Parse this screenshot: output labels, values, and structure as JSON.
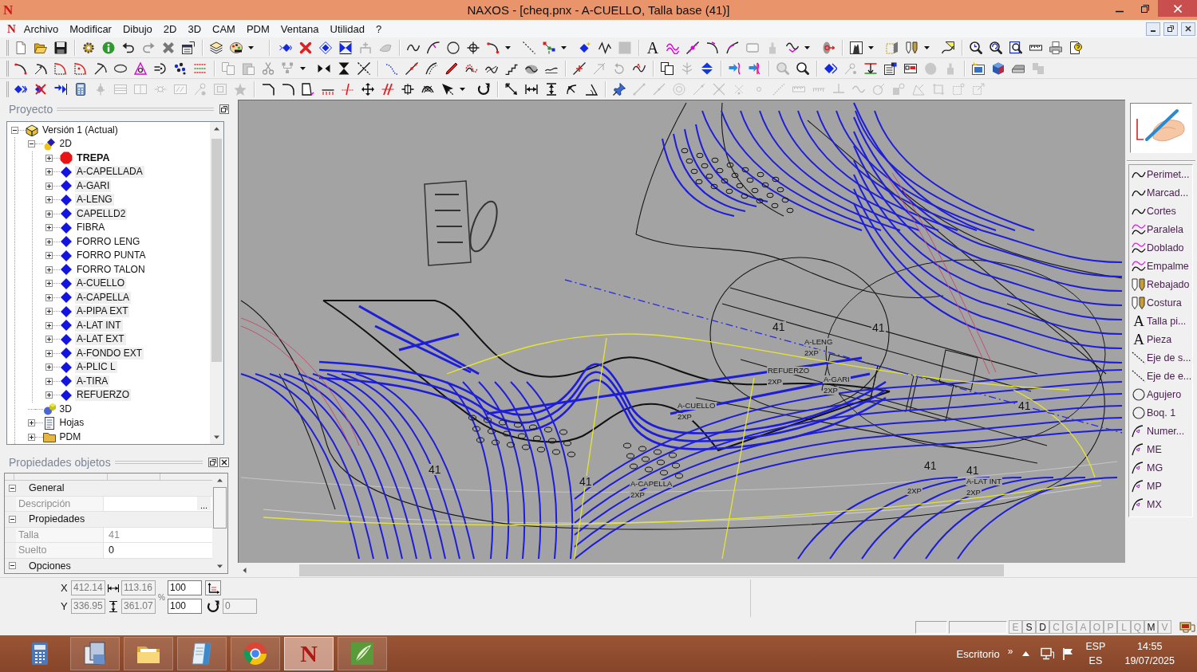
{
  "window": {
    "logo": "N",
    "title": "NAXOS - [cheq.pnx - A-CUELLO, Talla base (41)]"
  },
  "menu_bar": {
    "logo": "N",
    "items": [
      "Archivo",
      "Modificar",
      "Dibujo",
      "2D",
      "3D",
      "CAM",
      "PDM",
      "Ventana",
      "Utilidad",
      "?"
    ]
  },
  "toolbars": [
    {
      "groups": [
        [
          {
            "kind": "button",
            "disabled": false
          },
          {
            "kind": "button",
            "disabled": false
          },
          {
            "kind": "button",
            "disabled": false
          }
        ],
        [
          {
            "kind": "button",
            "disabled": false
          },
          {
            "kind": "button",
            "disabled": false
          },
          {
            "kind": "button",
            "disabled": false
          },
          {
            "kind": "button",
            "disabled": true
          },
          {
            "kind": "button",
            "disabled": false
          },
          {
            "kind": "button",
            "disabled": false
          }
        ],
        [
          {
            "kind": "button",
            "disabled": false
          },
          {
            "kind": "menu_button",
            "disabled": false
          }
        ],
        [
          {
            "kind": "button",
            "disabled": false
          },
          {
            "kind": "button",
            "disabled": false
          },
          {
            "kind": "button",
            "disabled": false
          },
          {
            "kind": "button",
            "disabled": false
          },
          {
            "kind": "button",
            "disabled": true
          },
          {
            "kind": "button",
            "disabled": true
          }
        ],
        [
          {
            "kind": "button",
            "disabled": false
          },
          {
            "kind": "button",
            "disabled": false
          },
          {
            "kind": "button",
            "disabled": false
          },
          {
            "kind": "button",
            "disabled": false
          },
          {
            "kind": "menu_button",
            "disabled": false
          },
          {
            "kind": "button",
            "disabled": false
          },
          {
            "kind": "menu_button",
            "disabled": false
          },
          {
            "kind": "button",
            "disabled": false
          },
          {
            "kind": "button",
            "disabled": false
          },
          {
            "kind": "button",
            "disabled": true
          }
        ],
        [
          {
            "kind": "button",
            "glyph": "A",
            "disabled": false
          },
          {
            "kind": "button",
            "disabled": false
          },
          {
            "kind": "button",
            "disabled": false
          },
          {
            "kind": "button",
            "disabled": false
          },
          {
            "kind": "button",
            "disabled": false
          },
          {
            "kind": "button",
            "disabled": true
          },
          {
            "kind": "button",
            "disabled": true
          },
          {
            "kind": "menu_button",
            "disabled": false
          },
          {
            "kind": "button",
            "disabled": false
          }
        ],
        [
          {
            "kind": "menu_button",
            "disabled": false
          },
          {
            "kind": "button",
            "disabled": false
          },
          {
            "kind": "menu_button",
            "disabled": false
          },
          {
            "kind": "button",
            "disabled": false
          }
        ],
        [
          {
            "kind": "button",
            "disabled": false
          },
          {
            "kind": "button",
            "disabled": false
          },
          {
            "kind": "button",
            "disabled": false
          },
          {
            "kind": "button",
            "disabled": false
          },
          {
            "kind": "button",
            "disabled": false
          },
          {
            "kind": "button",
            "disabled": false
          }
        ]
      ]
    },
    {
      "groups": [
        [
          {
            "kind": "button",
            "disabled": false
          },
          {
            "kind": "button",
            "disabled": false
          },
          {
            "kind": "button",
            "disabled": false
          },
          {
            "kind": "button",
            "disabled": false
          },
          {
            "kind": "button",
            "disabled": false
          },
          {
            "kind": "button",
            "disabled": false
          },
          {
            "kind": "button",
            "disabled": false
          },
          {
            "kind": "button",
            "disabled": false
          },
          {
            "kind": "button",
            "disabled": false
          },
          {
            "kind": "button",
            "disabled": false
          }
        ],
        [
          {
            "kind": "button",
            "disabled": true
          },
          {
            "kind": "button",
            "disabled": true
          },
          {
            "kind": "button",
            "disabled": true
          },
          {
            "kind": "menu_button",
            "disabled": true
          },
          {
            "kind": "button",
            "disabled": false
          },
          {
            "kind": "button",
            "disabled": false
          },
          {
            "kind": "button",
            "disabled": false
          }
        ],
        [
          {
            "kind": "button",
            "disabled": false
          },
          {
            "kind": "button",
            "disabled": false
          },
          {
            "kind": "button",
            "disabled": false
          },
          {
            "kind": "button",
            "disabled": false
          },
          {
            "kind": "button",
            "disabled": false
          },
          {
            "kind": "button",
            "disabled": false
          },
          {
            "kind": "button",
            "disabled": false
          },
          {
            "kind": "button",
            "disabled": false
          },
          {
            "kind": "button",
            "disabled": false
          }
        ],
        [
          {
            "kind": "button",
            "disabled": false
          },
          {
            "kind": "button",
            "disabled": true
          },
          {
            "kind": "button",
            "disabled": true
          },
          {
            "kind": "button",
            "disabled": false
          }
        ],
        [
          {
            "kind": "button",
            "disabled": false
          },
          {
            "kind": "button",
            "disabled": true
          },
          {
            "kind": "button",
            "disabled": false
          }
        ],
        [
          {
            "kind": "button",
            "disabled": false
          },
          {
            "kind": "button",
            "disabled": false
          }
        ],
        [
          {
            "kind": "button",
            "disabled": true
          },
          {
            "kind": "button",
            "disabled": false
          }
        ],
        [
          {
            "kind": "button",
            "disabled": false
          },
          {
            "kind": "button",
            "disabled": true
          },
          {
            "kind": "button",
            "disabled": false
          },
          {
            "kind": "button",
            "disabled": false
          },
          {
            "kind": "button",
            "disabled": false
          },
          {
            "kind": "button",
            "disabled": true
          },
          {
            "kind": "button",
            "disabled": true
          }
        ],
        [
          {
            "kind": "button",
            "disabled": false
          },
          {
            "kind": "button",
            "disabled": false
          },
          {
            "kind": "button",
            "disabled": false
          },
          {
            "kind": "button",
            "disabled": true
          }
        ]
      ]
    },
    {
      "groups": [
        [
          {
            "kind": "button",
            "disabled": false
          },
          {
            "kind": "button",
            "disabled": false
          },
          {
            "kind": "button",
            "disabled": false
          },
          {
            "kind": "button",
            "disabled": false
          },
          {
            "kind": "button",
            "disabled": true
          },
          {
            "kind": "button",
            "disabled": true
          },
          {
            "kind": "button",
            "disabled": true
          },
          {
            "kind": "button",
            "disabled": true
          },
          {
            "kind": "button",
            "disabled": true
          },
          {
            "kind": "button",
            "disabled": true
          },
          {
            "kind": "button",
            "disabled": true
          },
          {
            "kind": "button",
            "disabled": true
          }
        ],
        [
          {
            "kind": "button",
            "disabled": false
          },
          {
            "kind": "button",
            "disabled": false
          },
          {
            "kind": "button",
            "disabled": false
          },
          {
            "kind": "button",
            "disabled": false
          },
          {
            "kind": "button",
            "disabled": false
          },
          {
            "kind": "button",
            "disabled": false
          },
          {
            "kind": "button",
            "disabled": false
          },
          {
            "kind": "button",
            "disabled": false
          },
          {
            "kind": "button",
            "disabled": false
          },
          {
            "kind": "menu_button",
            "disabled": false
          },
          {
            "kind": "button",
            "disabled": false
          }
        ],
        [
          {
            "kind": "button",
            "disabled": false
          },
          {
            "kind": "button",
            "disabled": false
          },
          {
            "kind": "button",
            "disabled": false
          },
          {
            "kind": "button",
            "disabled": false
          },
          {
            "kind": "button",
            "disabled": false
          }
        ],
        [
          {
            "kind": "button",
            "disabled": false
          },
          {
            "kind": "button",
            "disabled": true
          },
          {
            "kind": "button",
            "disabled": true
          },
          {
            "kind": "button",
            "disabled": true
          },
          {
            "kind": "button",
            "disabled": true
          },
          {
            "kind": "button",
            "disabled": true
          },
          {
            "kind": "button",
            "disabled": true
          },
          {
            "kind": "button",
            "disabled": true
          },
          {
            "kind": "button",
            "disabled": true
          },
          {
            "kind": "button",
            "disabled": true
          },
          {
            "kind": "button",
            "disabled": true
          },
          {
            "kind": "button",
            "disabled": true
          },
          {
            "kind": "button",
            "disabled": true
          },
          {
            "kind": "button",
            "disabled": true
          },
          {
            "kind": "button",
            "disabled": true
          },
          {
            "kind": "button",
            "disabled": true
          },
          {
            "kind": "button",
            "disabled": true
          },
          {
            "kind": "button",
            "disabled": true
          },
          {
            "kind": "button",
            "disabled": true
          }
        ]
      ]
    }
  ],
  "project_panel": {
    "title": "Proyecto",
    "tree": [
      {
        "label": "Versión 1 (Actual)",
        "expanded": true,
        "children": [
          {
            "label": "2D",
            "expanded": true,
            "children": [
              {
                "label": "TREPA",
                "expanded": false,
                "active": true,
                "marked": false
              },
              {
                "label": "A-CAPELLADA",
                "expanded": false,
                "active": false,
                "marked": true
              },
              {
                "label": "A-GARI",
                "expanded": false,
                "active": false,
                "marked": true
              },
              {
                "label": "A-LENG",
                "expanded": false,
                "active": false,
                "marked": true
              },
              {
                "label": "CAPELLD2",
                "expanded": false,
                "active": false,
                "marked": true
              },
              {
                "label": "FIBRA",
                "expanded": false,
                "active": false,
                "marked": false
              },
              {
                "label": "FORRO LENG",
                "expanded": false,
                "active": false,
                "marked": false
              },
              {
                "label": "FORRO PUNTA",
                "expanded": false,
                "active": false,
                "marked": false
              },
              {
                "label": "FORRO TALON",
                "expanded": false,
                "active": false,
                "marked": false
              },
              {
                "label": "A-CUELLO",
                "expanded": false,
                "active": false,
                "marked": true
              },
              {
                "label": "A-CAPELLA",
                "expanded": false,
                "active": false,
                "marked": true
              },
              {
                "label": "A-PIPA EXT",
                "expanded": false,
                "active": false,
                "marked": true
              },
              {
                "label": "A-LAT INT",
                "expanded": false,
                "active": false,
                "marked": true
              },
              {
                "label": "A-LAT EXT",
                "expanded": false,
                "active": false,
                "marked": true
              },
              {
                "label": "A-FONDO EXT",
                "expanded": false,
                "active": false,
                "marked": true
              },
              {
                "label": "A-PLIC L",
                "expanded": false,
                "active": false,
                "marked": true
              },
              {
                "label": "A-TIRA",
                "expanded": false,
                "active": false,
                "marked": true
              },
              {
                "label": "REFUERZO",
                "expanded": false,
                "active": false,
                "marked": true
              }
            ]
          },
          {
            "label": "3D"
          },
          {
            "label": "Hojas",
            "expanded": false
          },
          {
            "label": "PDM",
            "expanded": false
          }
        ]
      }
    ]
  },
  "properties_panel": {
    "title": "Propiedades objetos",
    "sections": [
      {
        "label": "General",
        "expanded": true,
        "rows": [
          {
            "name": "Descripción",
            "button": "...",
            "disabled": false
          }
        ]
      },
      {
        "label": "Propiedades",
        "expanded": true,
        "rows": [
          {
            "name": "Talla",
            "value": "41",
            "disabled": true
          },
          {
            "name": "Suelto",
            "value": "0",
            "disabled": false
          }
        ]
      },
      {
        "label": "Opciones",
        "expanded": true
      }
    ]
  },
  "canvas": {
    "labels": [
      "41",
      "41",
      "A-LENG",
      "2XP",
      "REFUERZO",
      "2XP",
      "A-GARI",
      "2XP",
      "A-CUELLO",
      "41",
      "2XP",
      "41",
      "41",
      "41",
      "41",
      "A-CAPELLA",
      "A-LAT INT",
      "2XP",
      "2XP",
      "2XP"
    ]
  },
  "tool_panel": {
    "items": [
      {
        "label": "Perimet..."
      },
      {
        "label": "Marcad..."
      },
      {
        "label": "Cortes"
      },
      {
        "label": "Paralela"
      },
      {
        "label": "Doblado"
      },
      {
        "label": "Empalme"
      },
      {
        "label": "Rebajado"
      },
      {
        "label": "Costura"
      },
      {
        "label": "Talla pi...",
        "glyph": "A"
      },
      {
        "label": "Pieza",
        "glyph": "A"
      },
      {
        "label": "Eje de s..."
      },
      {
        "label": "Eje de e..."
      },
      {
        "label": "Agujero"
      },
      {
        "label": "Boq. 1"
      },
      {
        "label": "Numer..."
      },
      {
        "label": "ME"
      },
      {
        "label": "MG"
      },
      {
        "label": "MP"
      },
      {
        "label": "MX"
      }
    ]
  },
  "coordinates": {
    "x_label": "X",
    "x": {
      "value": "412.14",
      "disabled": true
    },
    "width": {
      "value": "113.16",
      "disabled": true
    },
    "scale_unit": "%",
    "scale_x": {
      "value": "100",
      "disabled": false
    },
    "y_label": "Y",
    "y": {
      "value": "336.95",
      "disabled": true
    },
    "height": {
      "value": "361.07",
      "disabled": true
    },
    "scale_y": {
      "value": "100",
      "disabled": false
    },
    "angle": {
      "value": "0",
      "disabled": true
    }
  },
  "status_bar": {
    "indicators": [
      {
        "label": "E",
        "on": false
      },
      {
        "label": "S",
        "on": true
      },
      {
        "label": "D",
        "on": true
      },
      {
        "label": "C",
        "on": false
      },
      {
        "label": "G",
        "on": false
      },
      {
        "label": "A",
        "on": false
      },
      {
        "label": "O",
        "on": false
      },
      {
        "label": "P",
        "on": false
      },
      {
        "label": "L",
        "on": false
      },
      {
        "label": "Q",
        "on": false
      },
      {
        "label": "M",
        "on": true
      },
      {
        "label": "V",
        "on": false
      }
    ]
  },
  "taskbar": {
    "apps": [
      {
        "running": false,
        "active": false
      },
      {
        "running": true,
        "active": false
      },
      {
        "running": true,
        "active": false
      },
      {
        "running": true,
        "active": false
      },
      {
        "running": true,
        "active": false
      },
      {
        "glyph": "N",
        "running": true,
        "active": true
      },
      {
        "running": true,
        "active": false
      }
    ],
    "desktop_label": "Escritorio",
    "overflow": "»",
    "language": "ESP",
    "layout": "ES",
    "time": "14:55",
    "date": "19/07/2025"
  }
}
